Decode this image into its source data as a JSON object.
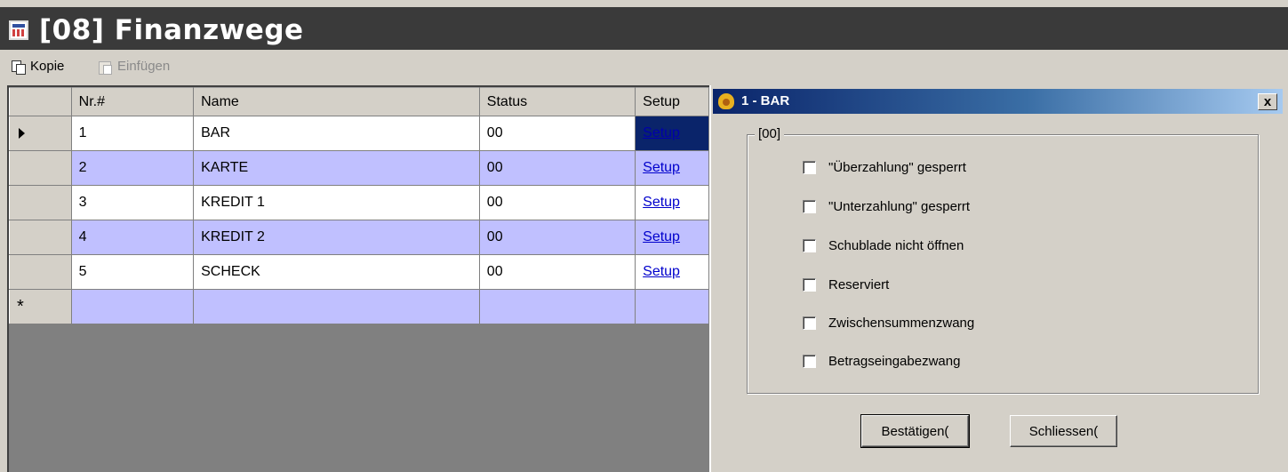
{
  "window": {
    "title": "[08] Finanzwege"
  },
  "toolbar": {
    "copy_label": "Kopie",
    "paste_label": "Einfügen"
  },
  "grid": {
    "columns": [
      "Nr.#",
      "Name",
      "Status",
      "Setup"
    ],
    "rows": [
      {
        "nr": "1",
        "name": "BAR",
        "status": "00",
        "setup": "Setup"
      },
      {
        "nr": "2",
        "name": "KARTE",
        "status": "00",
        "setup": "Setup"
      },
      {
        "nr": "3",
        "name": "KREDIT 1",
        "status": "00",
        "setup": "Setup"
      },
      {
        "nr": "4",
        "name": "KREDIT 2",
        "status": "00",
        "setup": "Setup"
      },
      {
        "nr": "5",
        "name": "SCHECK",
        "status": "00",
        "setup": "Setup"
      }
    ],
    "new_row_marker": "*",
    "colors": {
      "alt_row": "#c0c0ff",
      "selected": "#0a246a"
    }
  },
  "dialog": {
    "title": "1 - BAR",
    "close_label": "x",
    "group_label": "[00]",
    "options": [
      "\"Überzahlung\" gesperrt",
      "\"Unterzahlung\" gesperrt",
      "Schublade nicht öffnen",
      "Reserviert",
      "Zwischensummenzwang",
      "Betragseingabezwang"
    ],
    "confirm_label": "Bestätigen(",
    "close_button_label": "Schliessen("
  }
}
